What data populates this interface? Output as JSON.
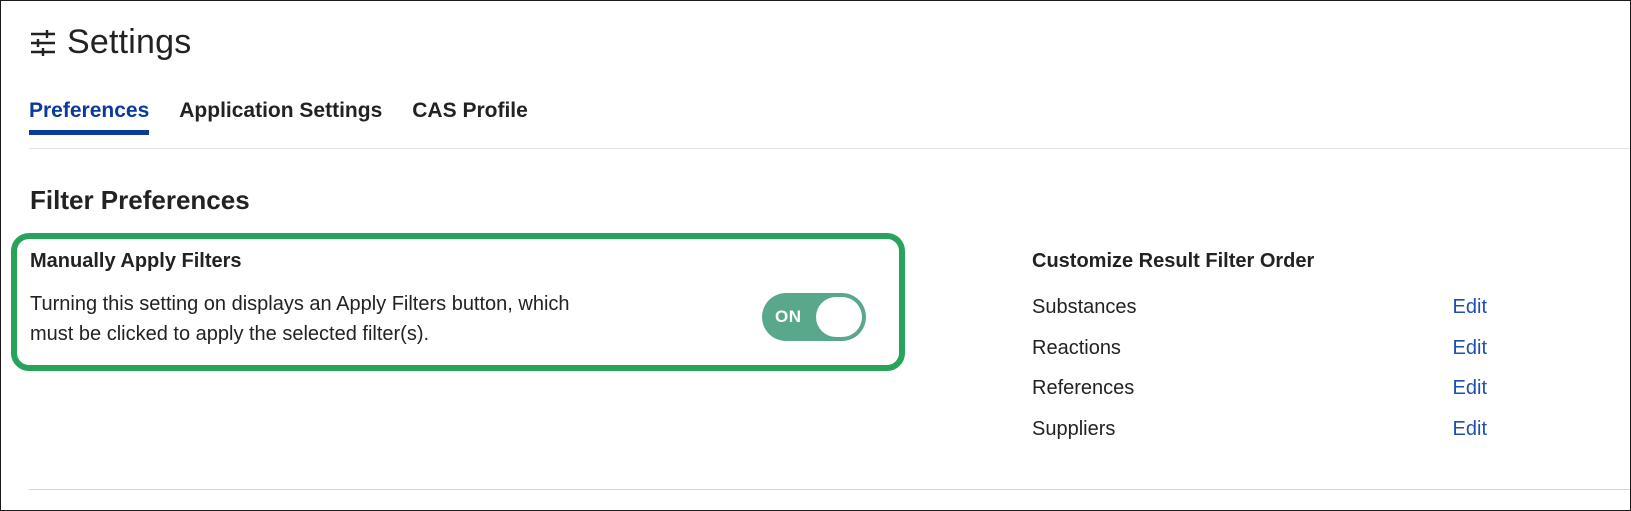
{
  "header": {
    "title": "Settings",
    "icon": "sliders-icon"
  },
  "tabs": [
    {
      "label": "Preferences",
      "active": true
    },
    {
      "label": "Application Settings",
      "active": false
    },
    {
      "label": "CAS Profile",
      "active": false
    }
  ],
  "filter_preferences": {
    "section_title": "Filter Preferences",
    "manual_apply": {
      "label": "Manually Apply Filters",
      "description": "Turning this setting on displays an Apply Filters button, which must be clicked to apply the selected filter(s).",
      "toggle_text": "ON",
      "toggle_state": true
    },
    "result_filter_order": {
      "title": "Customize Result Filter Order",
      "items": [
        {
          "name": "Substances",
          "action": "Edit"
        },
        {
          "name": "Reactions",
          "action": "Edit"
        },
        {
          "name": "References",
          "action": "Edit"
        },
        {
          "name": "Suppliers",
          "action": "Edit"
        }
      ]
    }
  },
  "colors": {
    "accent": "#0b3a9e",
    "link": "#1f4fb0",
    "toggle_on": "#5aa88c",
    "highlight": "#27a35a"
  }
}
